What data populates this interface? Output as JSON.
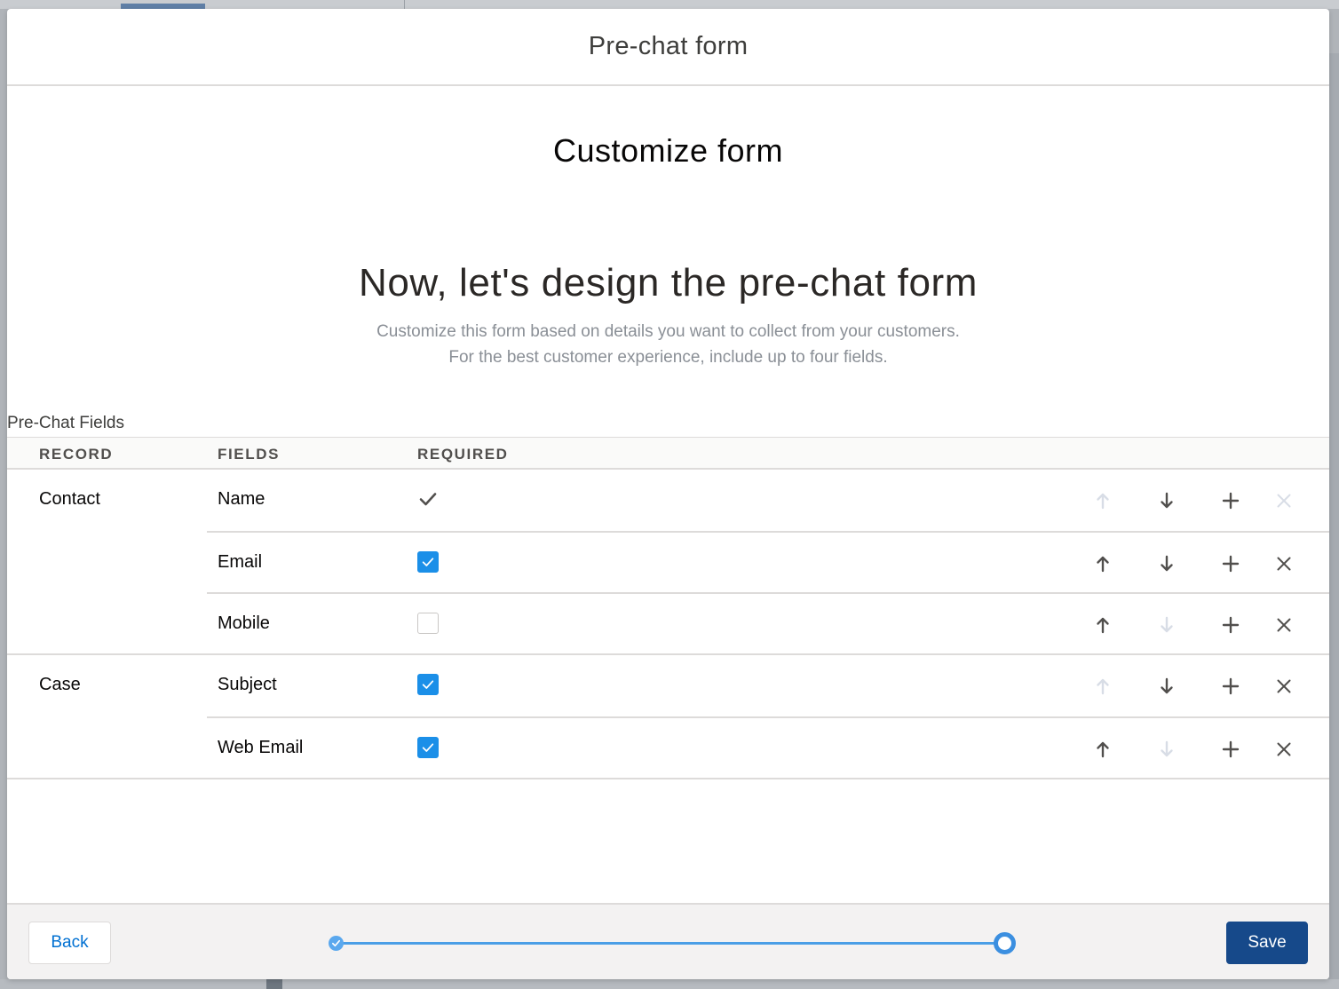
{
  "modal": {
    "title": "Pre-chat form"
  },
  "step": {
    "title": "Customize form",
    "heading": "Now, let's design the pre-chat form",
    "description_line1": "Customize this form based on details you want to collect from your customers.",
    "description_line2": "For the best customer experience, include up to four fields."
  },
  "section": {
    "label": "Pre-Chat Fields"
  },
  "table": {
    "columns": [
      "RECORD",
      "FIELDS",
      "REQUIRED"
    ],
    "groups": [
      {
        "record": "Contact",
        "rows": [
          {
            "field": "Name",
            "required": "always",
            "up_enabled": false,
            "down_enabled": true,
            "remove_enabled": false
          },
          {
            "field": "Email",
            "required": "checked",
            "up_enabled": true,
            "down_enabled": true,
            "remove_enabled": true
          },
          {
            "field": "Mobile",
            "required": "unchecked",
            "up_enabled": true,
            "down_enabled": false,
            "remove_enabled": true
          }
        ]
      },
      {
        "record": "Case",
        "rows": [
          {
            "field": "Subject",
            "required": "checked",
            "up_enabled": false,
            "down_enabled": true,
            "remove_enabled": true
          },
          {
            "field": "Web Email",
            "required": "checked",
            "up_enabled": true,
            "down_enabled": false,
            "remove_enabled": true
          }
        ]
      }
    ]
  },
  "footer": {
    "back_label": "Back",
    "save_label": "Save",
    "progress": {
      "total_steps": 2,
      "current_step": 2
    }
  },
  "colors": {
    "accent": "#1b8fe8",
    "save_button": "#16498a",
    "link": "#0070d2",
    "icon_enabled": "#514f4d",
    "icon_disabled": "#d8dde6"
  },
  "icons": {
    "up": "arrow-up-icon",
    "down": "arrow-down-icon",
    "add": "plus-icon",
    "remove": "close-icon",
    "required_static": "check-icon"
  }
}
